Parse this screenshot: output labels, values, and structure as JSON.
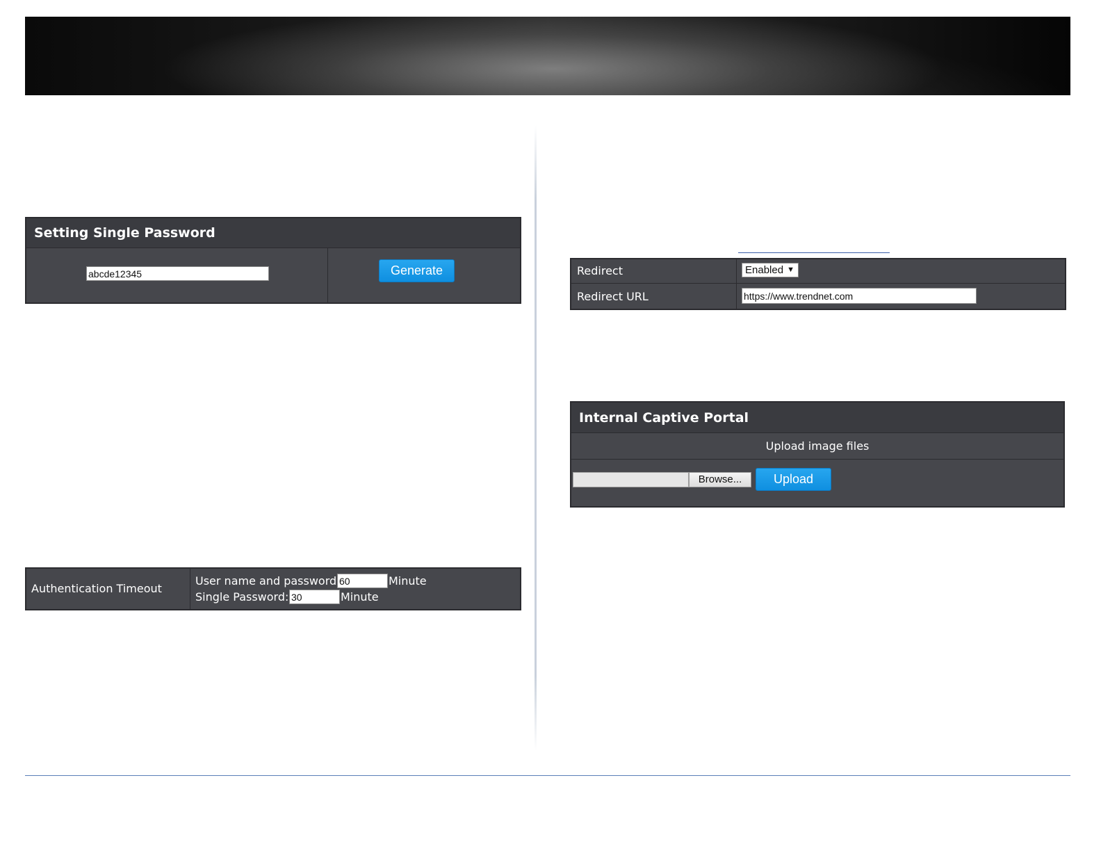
{
  "single_password_panel": {
    "title": "Setting Single Password",
    "password_value": "abcde12345",
    "generate_label": "Generate"
  },
  "auth_timeout_panel": {
    "label": "Authentication Timeout",
    "user_pass_label": "User name and password:",
    "user_pass_value": "60",
    "user_pass_unit": "Minute",
    "single_pass_label": "Single Password:",
    "single_pass_value": "30",
    "single_pass_unit": "Minute"
  },
  "redirect_panel": {
    "redirect_label": "Redirect",
    "redirect_selected": "Enabled",
    "redirect_url_label": "Redirect URL",
    "redirect_url_value": "https://www.trendnet.com"
  },
  "captive_portal_panel": {
    "title": "Internal Captive Portal",
    "subtitle": "Upload image files",
    "browse_label": "Browse...",
    "upload_label": "Upload"
  },
  "icons": {
    "dropdown": "chevron-down-icon"
  },
  "colors": {
    "panel_bg": "#46474c",
    "panel_header_bg": "#3a3b40",
    "accent_blue": "#1a9be6",
    "footer_line": "#5a7fb8"
  }
}
